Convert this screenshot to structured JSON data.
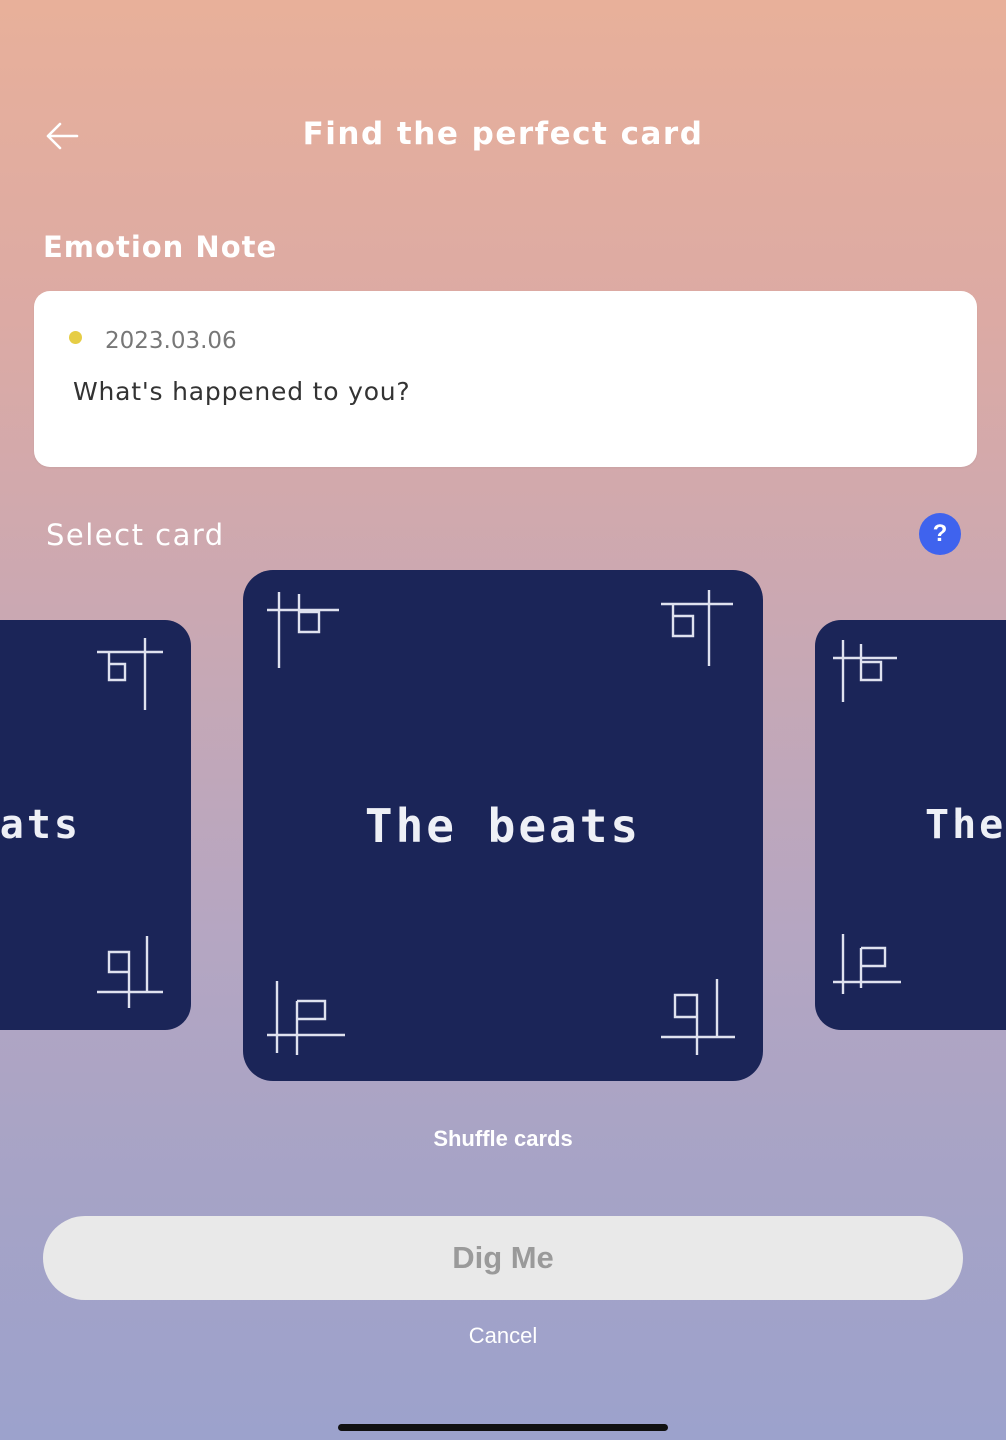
{
  "header": {
    "title": "Find the perfect card",
    "back_icon": "arrow-left-icon"
  },
  "emotion_note": {
    "section_title": "Emotion Note",
    "date": "2023.03.06",
    "question": "What's happened to you?",
    "dot_color": "#e6cd45"
  },
  "select_card": {
    "label": "Select card",
    "help_label": "?"
  },
  "cards": {
    "left": {
      "title": "The beats"
    },
    "center": {
      "title": "The beats"
    },
    "right": {
      "title": "The beats"
    },
    "color": "#1b2558"
  },
  "actions": {
    "shuffle_label": "Shuffle cards",
    "dig_label": "Dig Me",
    "cancel_label": "Cancel"
  },
  "colors": {
    "help_button": "#3f63ee",
    "dig_button_bg": "#e9e9e9",
    "dig_button_text": "#9a9a9a"
  }
}
